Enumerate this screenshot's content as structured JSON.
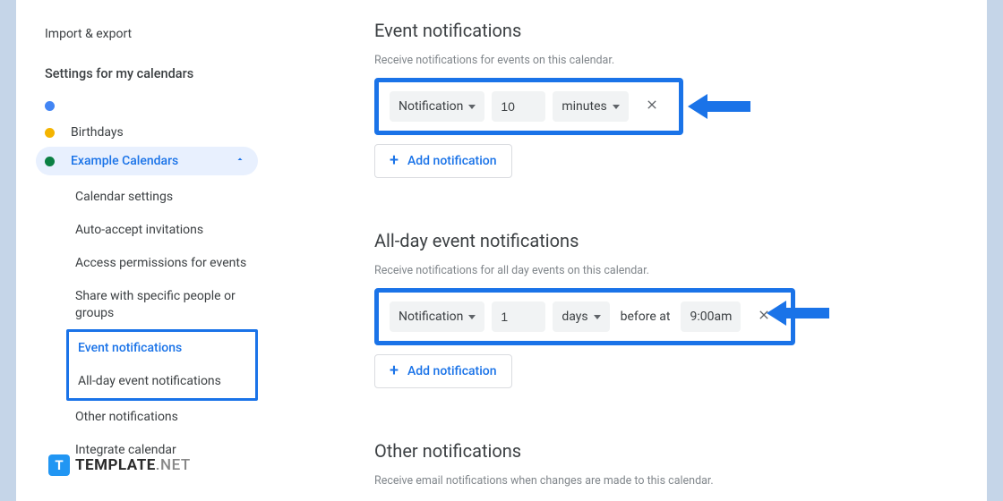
{
  "sidebar": {
    "import_export": "Import & export",
    "section_title": "Settings for my calendars",
    "calendars": [
      {
        "name": "",
        "color": "#4285f4"
      },
      {
        "name": "Birthdays",
        "color": "#f4b400"
      },
      {
        "name": "Example Calendars",
        "color": "#0b8043",
        "active": true
      }
    ],
    "subitems": [
      "Calendar settings",
      "Auto-accept invitations",
      "Access permissions for events",
      "Share with specific people or groups",
      "Event notifications",
      "All-day event notifications",
      "Other notifications",
      "Integrate calendar"
    ]
  },
  "main": {
    "event_notif": {
      "title": "Event notifications",
      "desc": "Receive notifications for events on this calendar.",
      "type_label": "Notification",
      "value": "10",
      "unit_label": "minutes",
      "add_label": "Add notification"
    },
    "allday_notif": {
      "title": "All-day event notifications",
      "desc": "Receive notifications for all day events on this calendar.",
      "type_label": "Notification",
      "value": "1",
      "unit_label": "days",
      "before_text": "before at",
      "time": "9:00am",
      "add_label": "Add notification"
    },
    "other_notif": {
      "title": "Other notifications",
      "desc": "Receive email notifications when changes are made to this calendar."
    }
  },
  "watermark": {
    "brand": "TEMPLATE",
    "suffix": ".NET"
  }
}
